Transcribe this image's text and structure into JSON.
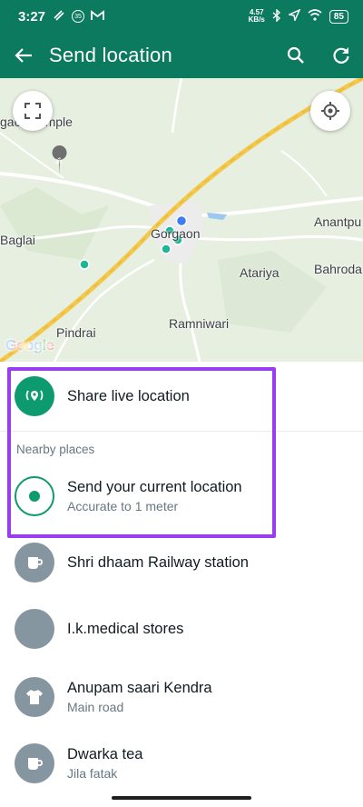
{
  "status_bar": {
    "time": "3:27",
    "badge": "35",
    "speed_value": "4.57",
    "speed_unit": "KB/s",
    "battery": "85"
  },
  "app_bar": {
    "title": "Send location",
    "back_icon": "arrow-left-icon",
    "search_icon": "search-icon",
    "refresh_icon": "refresh-icon"
  },
  "map": {
    "labels": {
      "temple": "gaon Temple",
      "gorgaon": "Gorgaon",
      "baglai": "Baglai",
      "anantpu": "Anantpu",
      "bahroda": "Bahroda",
      "atariya": "Atariya",
      "pindrai": "Pindrai",
      "ramniwari": "Ramniwari"
    },
    "google": "Google"
  },
  "list": {
    "live": {
      "label": "Share live location"
    },
    "section": "Nearby places",
    "current": {
      "label": "Send your current location",
      "sub": "Accurate to 1 meter"
    },
    "places": [
      {
        "name": "Shri dhaam Railway station",
        "sub": ""
      },
      {
        "name": "I.k.medical stores",
        "sub": ""
      },
      {
        "name": "Anupam saari Kendra",
        "sub": "Main road"
      },
      {
        "name": "Dwarka tea",
        "sub": "Jila fatak"
      }
    ]
  },
  "colors": {
    "header": "#0c7a5e",
    "accent": "#0c9a6e",
    "highlight": "#9a3df0"
  }
}
